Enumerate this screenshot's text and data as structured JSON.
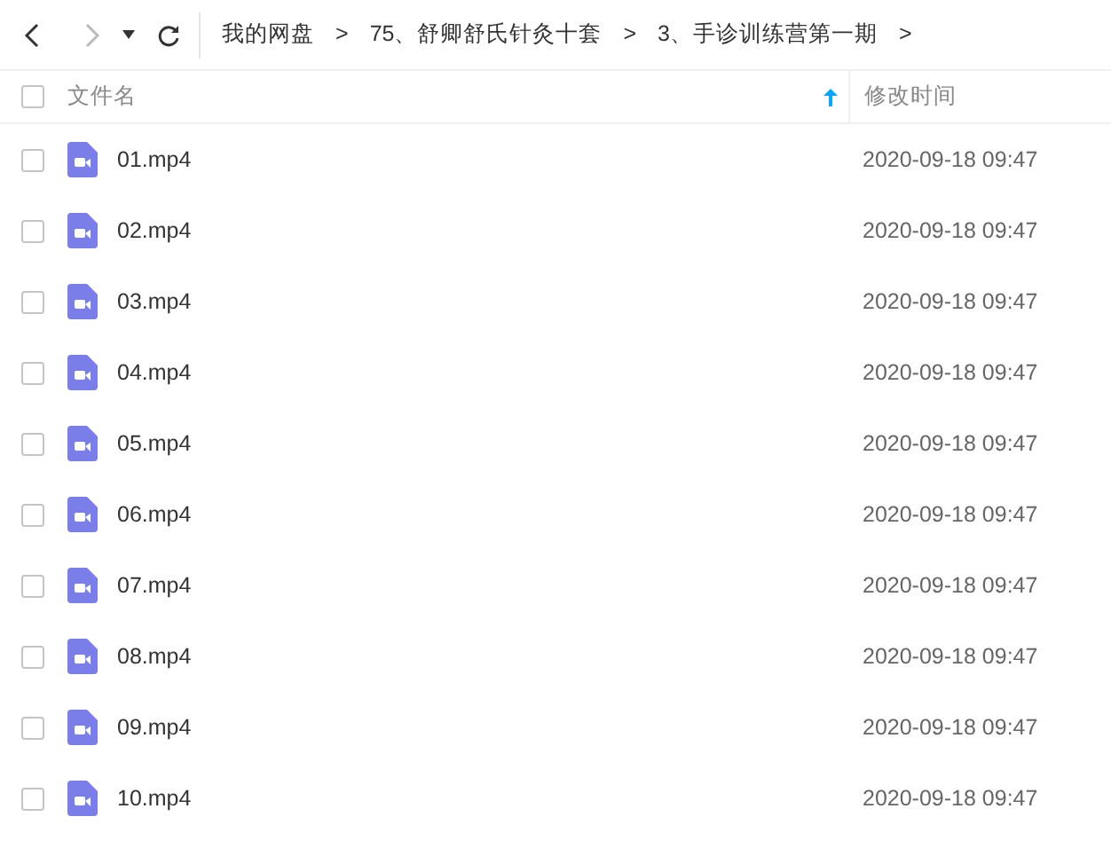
{
  "breadcrumb": [
    {
      "label": "我的网盘",
      "separator": ">"
    },
    {
      "label": "75、舒卿舒氏针灸十套",
      "separator": ">"
    },
    {
      "label": "3、手诊训练营第一期",
      "separator": ">"
    }
  ],
  "columns": {
    "select_all": {
      "checked": false
    },
    "name": "文件名",
    "modified": "修改时间"
  },
  "files": [
    {
      "name": "01.mp4",
      "modified": "2020-09-18 09:47",
      "checked": false
    },
    {
      "name": "02.mp4",
      "modified": "2020-09-18 09:47",
      "checked": false
    },
    {
      "name": "03.mp4",
      "modified": "2020-09-18 09:47",
      "checked": false
    },
    {
      "name": "04.mp4",
      "modified": "2020-09-18 09:47",
      "checked": false
    },
    {
      "name": "05.mp4",
      "modified": "2020-09-18 09:47",
      "checked": false
    },
    {
      "name": "06.mp4",
      "modified": "2020-09-18 09:47",
      "checked": false
    },
    {
      "name": "07.mp4",
      "modified": "2020-09-18 09:47",
      "checked": false
    },
    {
      "name": "08.mp4",
      "modified": "2020-09-18 09:47",
      "checked": false
    },
    {
      "name": "09.mp4",
      "modified": "2020-09-18 09:47",
      "checked": false
    },
    {
      "name": "10.mp4",
      "modified": "2020-09-18 09:47",
      "checked": false
    }
  ]
}
